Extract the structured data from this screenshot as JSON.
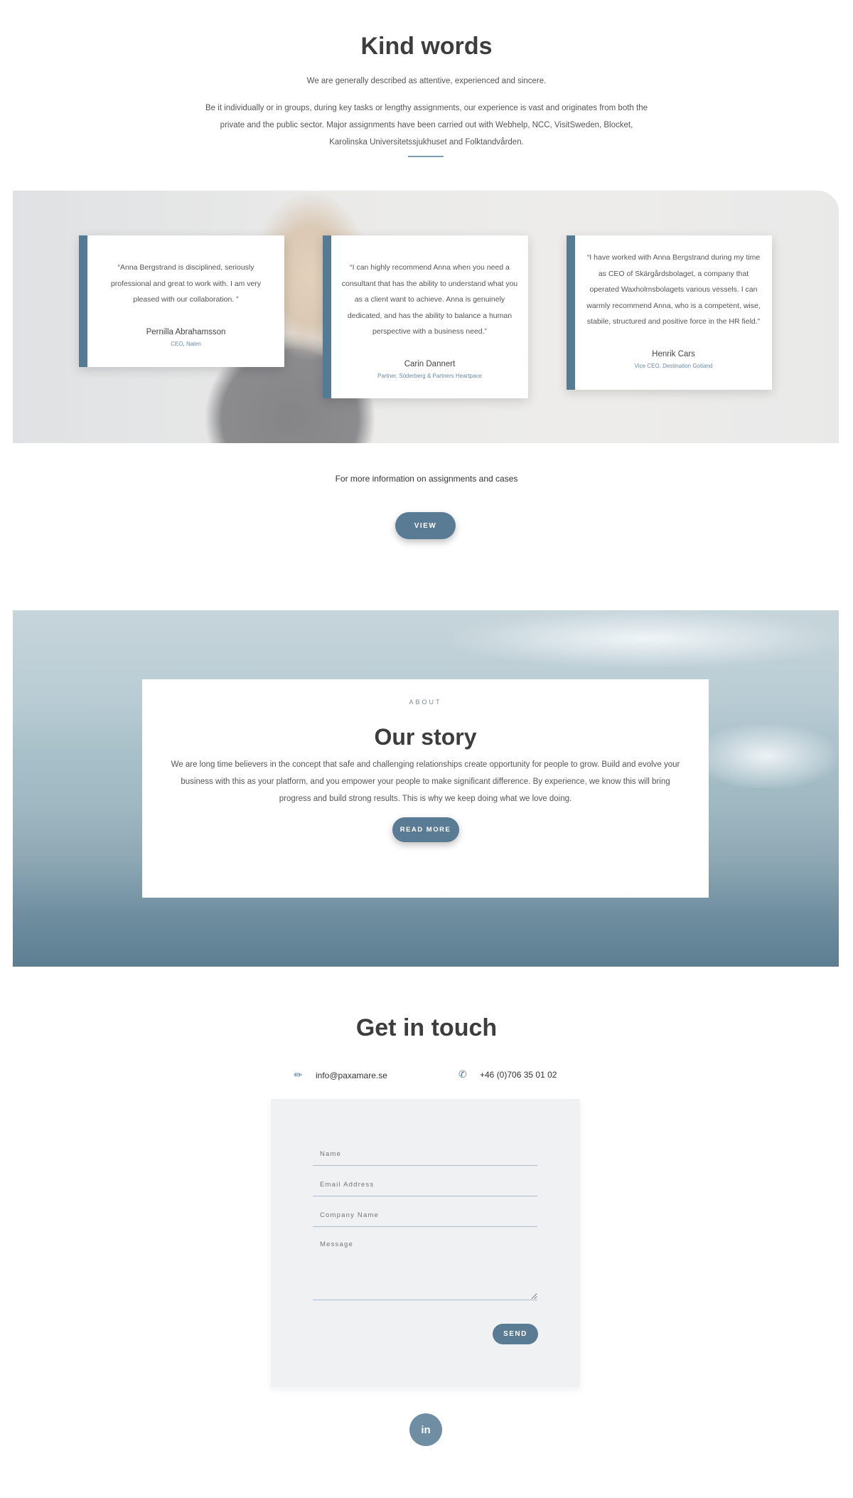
{
  "kind_words": {
    "title": "Kind words",
    "subtitle": "We are generally described as attentive, experienced and sincere.",
    "body": "Be it individually or in groups, during key tasks or lengthy assignments, our experience is vast and originates from both the private and the public sector. Major assignments have been carried out with Webhelp, NCC, VisitSweden, Blocket, Karolinska Universitetssjukhuset and Folktandvården."
  },
  "testimonials": [
    {
      "quote": "“Anna Bergstrand is disciplined, seriously professional and great to work with. I am very pleased with our collaboration. ”",
      "name": "Pernilla Abrahamsson",
      "role": "CEO, Nalen"
    },
    {
      "quote": "“I can highly recommend Anna when you need a consultant that has the ability to understand what you as a client want to achieve. Anna is genuinely dedicated, and has the ability to balance a human perspective with a business need.”",
      "name": "Carin Dannert",
      "role": "Partner, Söderberg & Partners Heartpace"
    },
    {
      "quote": "“I have worked with Anna Bergstrand during my time as CEO of Skärgårdsbolaget, a company that operated Waxholmsbolagets various vessels. I can warmly recommend Anna, who is a competent, wise, stabile, structured and positive force in the HR field.”",
      "name": "Henrik Cars",
      "role": "Vice CEO, Destination Gotland"
    }
  ],
  "more_info": {
    "text": "For more information on assignments and cases",
    "button": "VIEW"
  },
  "about": {
    "eyebrow": "ABOUT",
    "title": "Our story",
    "body": "We are long time believers in the concept that safe and challenging relationships create opportunity for people to grow. Build and evolve your business with this as your platform, and you empower your people to make significant difference. By experience, we know this will bring progress and build strong results. This is why we keep doing what we love doing.",
    "button": "READ MORE"
  },
  "contact": {
    "title": "Get in touch",
    "email": "info@paxamare.se",
    "email_icon": "pencil-icon",
    "phone": "+46 (0)706 35 01 02",
    "phone_icon": "phone-icon",
    "form": {
      "name_placeholder": "Name",
      "email_placeholder": "Email Address",
      "company_placeholder": "Company Name",
      "message_placeholder": "Message",
      "send": "SEND"
    },
    "social": "in"
  },
  "colors": {
    "accent": "#557a93",
    "text": "#3d3d3d"
  }
}
